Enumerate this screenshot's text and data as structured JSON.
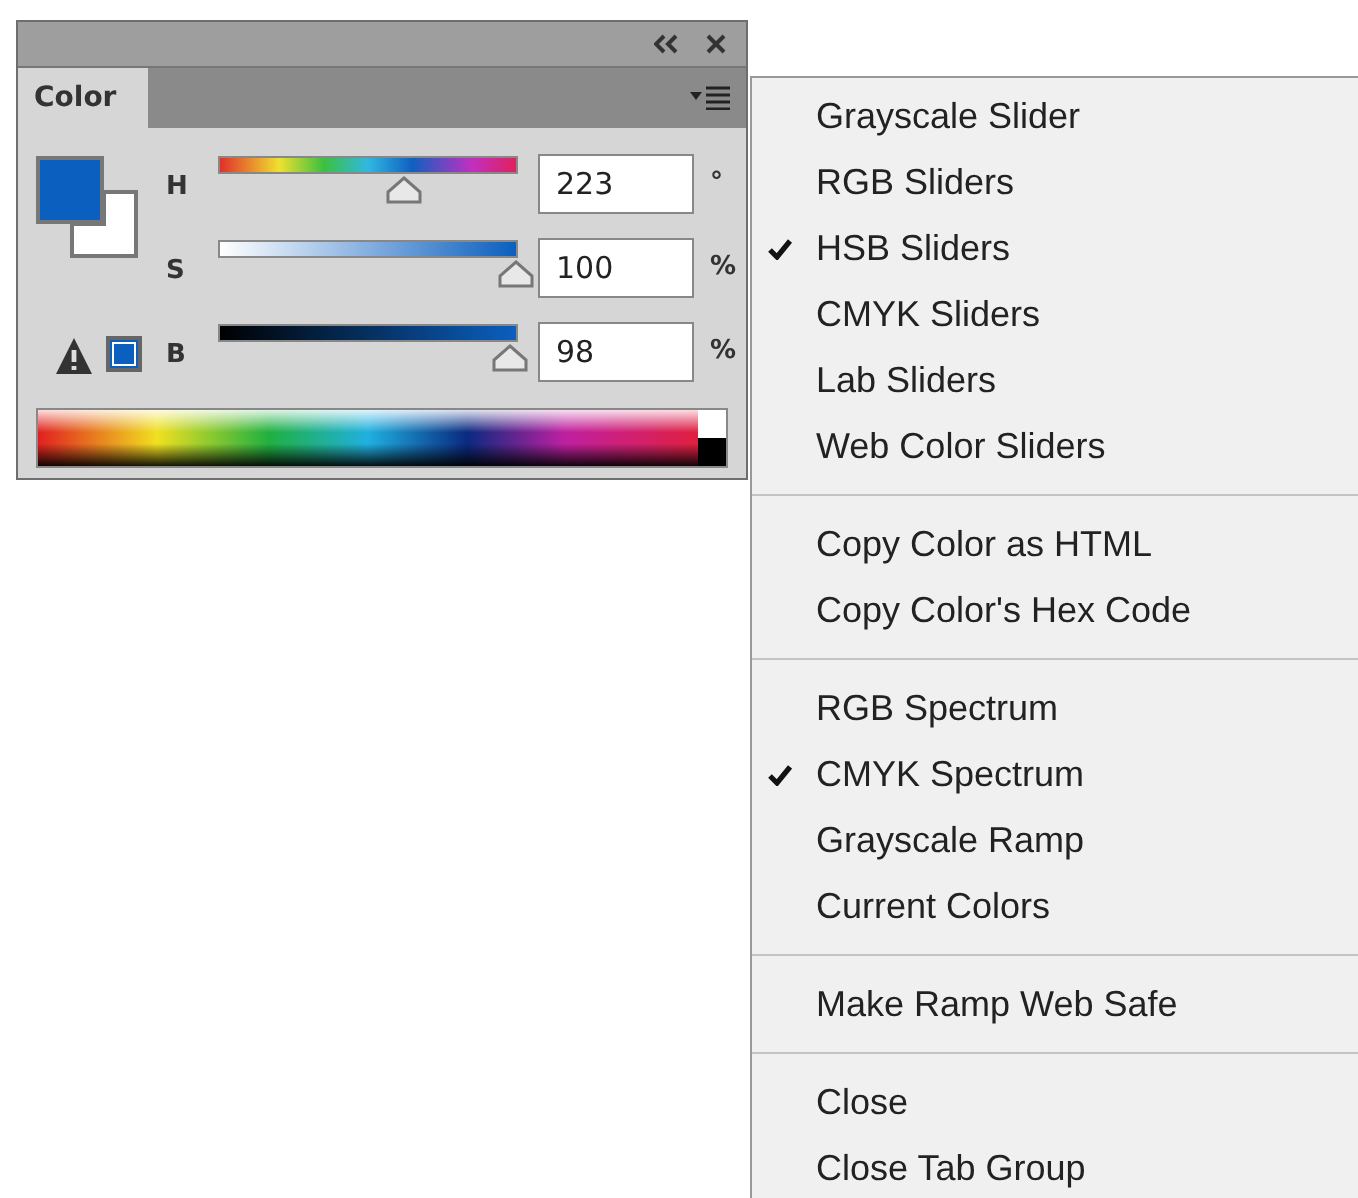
{
  "panel": {
    "tab": {
      "label": "Color",
      "selected": true
    },
    "swatches": [
      {
        "kind": "foreground",
        "color": "#0b5fbf"
      },
      {
        "kind": "background",
        "color": "#ffffff"
      }
    ],
    "gamut_warning": {
      "color": "#0b5fbf"
    },
    "sliders": [
      {
        "kind": "hue",
        "label": "H",
        "level": 0.62,
        "value": "223",
        "unit": "°"
      },
      {
        "kind": "saturation",
        "label": "S",
        "level": 1.0,
        "value": "100",
        "unit": "%"
      },
      {
        "kind": "brightness",
        "label": "B",
        "level": 0.98,
        "value": "98",
        "unit": "%"
      }
    ]
  },
  "menu": {
    "sections": [
      {
        "items": [
          {
            "label": "Grayscale Slider",
            "checked": false
          },
          {
            "label": "RGB Sliders",
            "checked": false
          },
          {
            "label": "HSB Sliders",
            "checked": true
          },
          {
            "label": "CMYK Sliders",
            "checked": false
          },
          {
            "label": "Lab Sliders",
            "checked": false
          },
          {
            "label": "Web Color Sliders",
            "checked": false
          }
        ]
      },
      {
        "items": [
          {
            "label": "Copy Color as HTML",
            "checked": false
          },
          {
            "label": "Copy Color's Hex Code",
            "checked": false
          }
        ]
      },
      {
        "items": [
          {
            "label": "RGB Spectrum",
            "checked": false
          },
          {
            "label": "CMYK Spectrum",
            "checked": true
          },
          {
            "label": "Grayscale Ramp",
            "checked": false
          },
          {
            "label": "Current Colors",
            "checked": false
          }
        ]
      },
      {
        "items": [
          {
            "label": "Make Ramp Web Safe",
            "checked": false
          }
        ]
      },
      {
        "items": [
          {
            "label": "Close",
            "checked": false
          },
          {
            "label": "Close Tab Group",
            "checked": false
          }
        ]
      }
    ]
  }
}
